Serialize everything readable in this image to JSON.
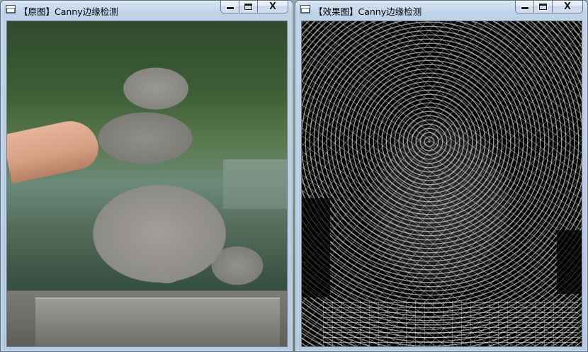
{
  "windows": {
    "original": {
      "title": "【原图】Canny边缘检测",
      "icon": "window-app-icon",
      "image_icon": "photo-stone-lion"
    },
    "result": {
      "title": "【效果图】Canny边缘检测",
      "icon": "window-app-icon",
      "image_icon": "canny-edge-map"
    }
  },
  "caption_buttons": {
    "minimize": "minimize-icon",
    "maximize": "maximize-icon",
    "close": "close-icon",
    "close_glyph": "X"
  },
  "colors": {
    "title_bar": "#bfd3e8",
    "edge_background": "#000000",
    "edge_lines": "#ffffff"
  }
}
